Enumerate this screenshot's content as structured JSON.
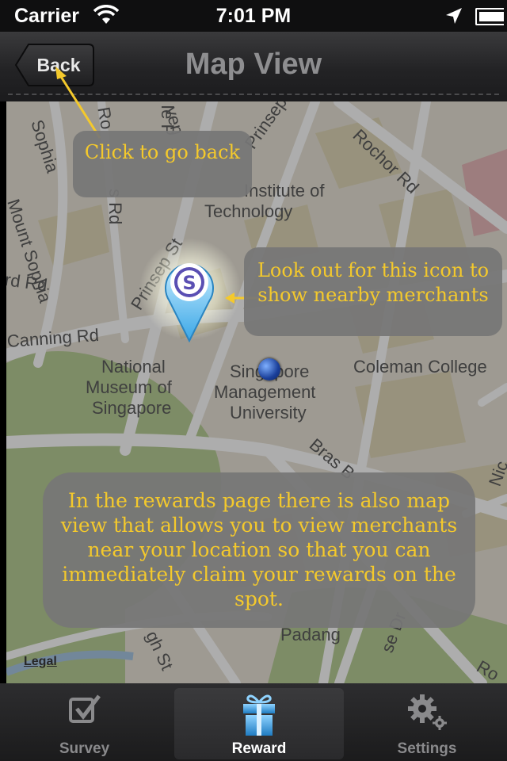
{
  "status_bar": {
    "carrier": "Carrier",
    "time": "7:01 PM",
    "icons": [
      "wifi-icon",
      "location-arrow-icon",
      "battery-icon"
    ]
  },
  "nav_bar": {
    "back_label": "Back",
    "title": "Map View"
  },
  "map": {
    "labels": [
      "Mount Sophia",
      "Sophia",
      "Prinsep",
      "Rochor Rd",
      "Institute of",
      "Technology",
      "Prinsep St",
      "rd Rd",
      "Canning Rd",
      "National",
      "Museum of",
      "Singapore",
      "Singapore",
      "Management",
      "University",
      "Coleman College",
      "Bras B",
      "Padang",
      "gh St",
      "se Dr",
      "Nic",
      "Ro",
      "Ie P",
      "ven",
      "s Rd",
      "Ro"
    ],
    "legal": "Legal"
  },
  "callouts": {
    "back": "Click to go back",
    "icon": "Look out for this icon to show nearby merchants",
    "info": "In the rewards page there is also map view that allows you to view merchants near your location so that you can immediately claim your rewards on the spot."
  },
  "pin_letter": "S",
  "tabs": [
    {
      "label": "Survey",
      "icon": "checkbox-icon",
      "selected": false
    },
    {
      "label": "Reward",
      "icon": "gift-icon",
      "selected": true
    },
    {
      "label": "Settings",
      "icon": "gear-icon",
      "selected": false
    }
  ],
  "colors": {
    "callout_text": "#f4c92c",
    "callout_bg": "#767676",
    "nav_bg": "#2a2a2c",
    "map_bg": "#e9e4d8"
  }
}
